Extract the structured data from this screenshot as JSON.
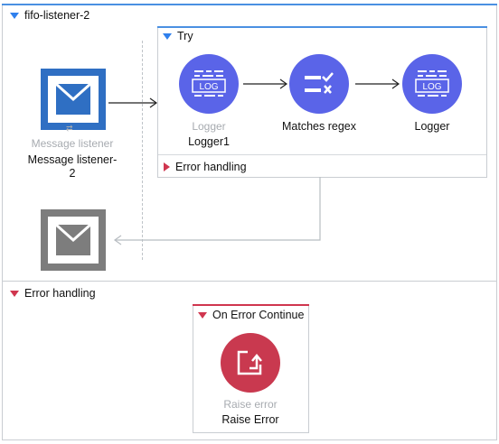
{
  "flow": {
    "title": "fifo-listener-2"
  },
  "source": {
    "type_label": "Message listener",
    "name": "Message listener-\n2"
  },
  "try_scope": {
    "title": "Try",
    "processors": [
      {
        "type_label": "Logger",
        "name": "Logger1",
        "icon": "log-icon"
      },
      {
        "type_label": "",
        "name": "Matches regex",
        "icon": "regex-check-icon"
      },
      {
        "type_label": "",
        "name": "Logger",
        "icon": "log-icon"
      }
    ],
    "error_handling_label": "Error handling"
  },
  "error_handling": {
    "title": "Error handling",
    "on_error": {
      "title": "On Error Continue",
      "processor": {
        "type_label": "Raise error",
        "name": "Raise Error",
        "icon": "raise-error-icon"
      }
    }
  },
  "colors": {
    "accent_blue": "#2f80ed",
    "processor_purple": "#5a64e8",
    "error_red": "#c9394f",
    "listener_blue": "#2f6fc3",
    "listener_grey": "#7d7d7d"
  }
}
